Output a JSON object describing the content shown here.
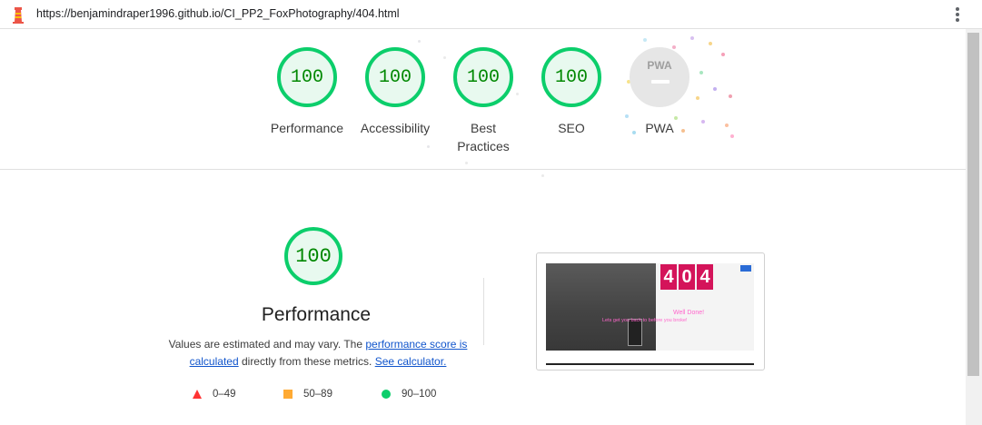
{
  "browser": {
    "url": "https://benjamindraper1996.github.io/CI_PP2_FoxPhotography/404.html",
    "app_icon": "lighthouse-icon",
    "menu_icon": "kebab-menu-icon"
  },
  "summary_gauges": [
    {
      "score": "100",
      "label": "Performance"
    },
    {
      "score": "100",
      "label": "Accessibility"
    },
    {
      "score": "100",
      "label": "Best Practices"
    },
    {
      "score": "100",
      "label": "SEO"
    }
  ],
  "pwa": {
    "badge": "PWA",
    "label": "PWA"
  },
  "performance": {
    "score": "100",
    "title": "Performance",
    "desc_prefix": "Values are estimated and may vary. The ",
    "link_score": "performance score is calculated",
    "desc_middle": " directly from these metrics. ",
    "link_calc": "See calculator.",
    "legend": [
      {
        "shape": "triangle",
        "range": "0–49",
        "color": "#ff3333"
      },
      {
        "shape": "square",
        "range": "50–89",
        "color": "#ffaa33"
      },
      {
        "shape": "circle",
        "range": "90–100",
        "color": "#0cce6b"
      }
    ]
  },
  "thumbnail": {
    "digits": [
      "4",
      "0",
      "4"
    ],
    "caption1": "Well Done!",
    "caption2": "Lets get you back to before you broke!"
  },
  "colors": {
    "pass": "#0cce6b",
    "pass_text": "#008800",
    "average": "#ffaa33",
    "fail": "#ff3333",
    "link": "#1155cc",
    "brand_404": "#d4145a"
  }
}
